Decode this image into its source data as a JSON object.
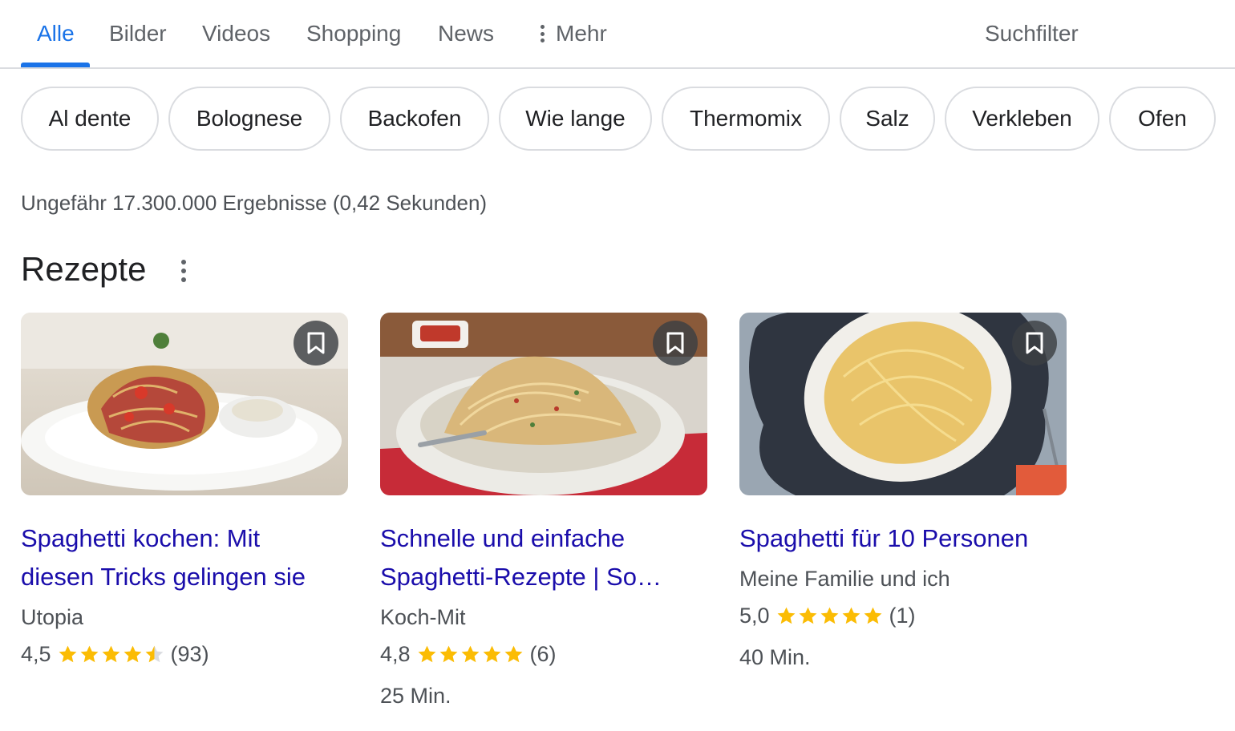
{
  "tabs": [
    {
      "label": "Alle"
    },
    {
      "label": "Bilder"
    },
    {
      "label": "Videos"
    },
    {
      "label": "Shopping"
    },
    {
      "label": "News"
    },
    {
      "label": "Mehr"
    }
  ],
  "suchfilter_label": "Suchfilter",
  "chips": [
    {
      "label": "Al dente"
    },
    {
      "label": "Bolognese"
    },
    {
      "label": "Backofen"
    },
    {
      "label": "Wie lange"
    },
    {
      "label": "Thermomix"
    },
    {
      "label": "Salz"
    },
    {
      "label": "Verkleben"
    },
    {
      "label": "Ofen"
    }
  ],
  "result_stats": "Ungefähr 17.300.000 Ergebnisse (0,42 Sekunden)",
  "section_title": "Rezepte",
  "recipes": [
    {
      "title_line1": "Spaghetti kochen: Mit",
      "title_line2": "diesen Tricks gelingen sie",
      "source": "Utopia",
      "rating": "4,5",
      "stars": 4.5,
      "reviews": "(93)",
      "duration": ""
    },
    {
      "title_line1": "Schnelle und einfache",
      "title_line2": "Spaghetti-Rezepte | So…",
      "source": "Koch-Mit",
      "rating": "4,8",
      "stars": 5,
      "reviews": "(6)",
      "duration": "25 Min."
    },
    {
      "title_line1": "Spaghetti für 10 Personen",
      "title_line2": "",
      "source": "Meine Familie und ich",
      "rating": "5,0",
      "stars": 5,
      "reviews": "(1)",
      "duration": "40 Min."
    }
  ],
  "colors": {
    "active_tab": "#1a73e8",
    "link": "#1a0dab",
    "star": "#fbbc04",
    "star_empty": "#dadce0"
  },
  "icons": {
    "more_menu": "more-vert-icon",
    "bookmark": "bookmark-icon",
    "star": "star-icon"
  }
}
